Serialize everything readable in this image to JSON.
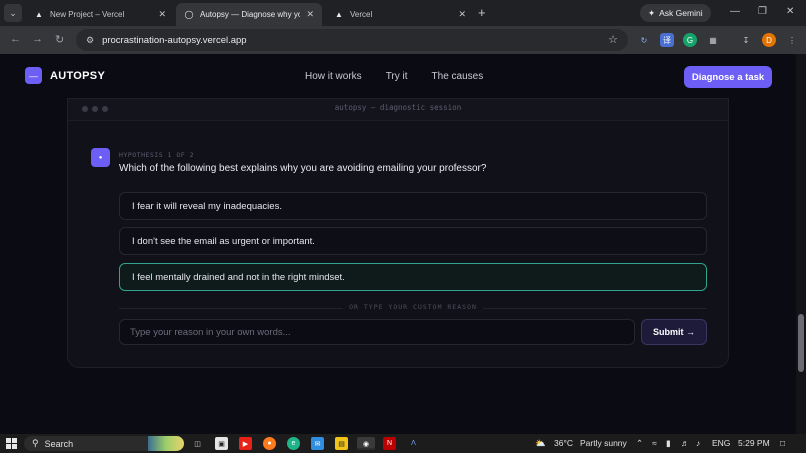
{
  "browser": {
    "tabs": [
      {
        "title": "New Project – Vercel",
        "icon": "vercel-triangle-icon",
        "active": false
      },
      {
        "title": "Autopsy — Diagnose why you'",
        "icon": "globe-icon",
        "active": true
      },
      {
        "title": "Vercel",
        "icon": "vercel-triangle-icon",
        "active": false
      }
    ],
    "gemini_label": "Ask Gemini",
    "url": "procrastination-autopsy.vercel.app"
  },
  "site": {
    "logo_text": "AUTOPSY",
    "nav": [
      "How it works",
      "Try it",
      "The causes"
    ],
    "cta_label": "Diagnose a task"
  },
  "session": {
    "title": "autopsy — diagnostic session",
    "hypothesis_label": "HYPOTHESIS 1 OF 2",
    "question": "Which of the following best explains why you are avoiding emailing your professor?",
    "options": [
      {
        "text": "I fear it will reveal my inadequacies.",
        "selected": false
      },
      {
        "text": "I don't see the email as urgent or important.",
        "selected": false
      },
      {
        "text": "I feel mentally drained and not in the right mindset.",
        "selected": true
      }
    ],
    "divider_text": "OR TYPE YOUR CUSTOM REASON",
    "reason_placeholder": "Type your reason in your own words...",
    "submit_label": "Submit →"
  },
  "taskbar": {
    "search_label": "Search",
    "weather": "36°C",
    "weather_desc": "Partly sunny",
    "language": "ENG",
    "time": "5:29 PM"
  },
  "colors": {
    "accent": "#6d5ef5",
    "selected_border": "#2fa38e",
    "page_bg": "#0b0b14"
  }
}
